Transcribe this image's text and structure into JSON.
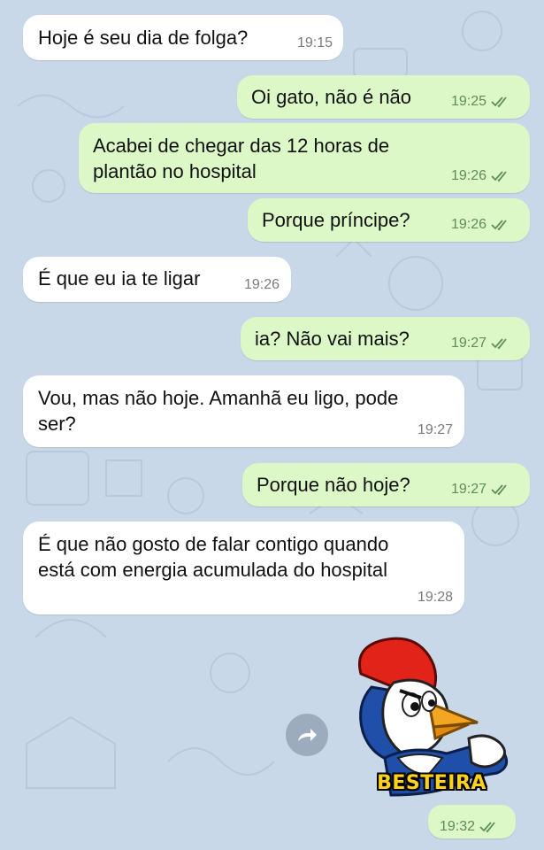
{
  "chat": {
    "messages": [
      {
        "direction": "incoming",
        "text": "Hoje é seu dia de folga?",
        "time": "19:15"
      },
      {
        "direction": "outgoing",
        "text": "Oi gato, não é não",
        "time": "19:25",
        "status": "read"
      },
      {
        "direction": "outgoing",
        "text": "Acabei de chegar das 12 horas de\nplantão no hospital",
        "time": "19:26",
        "status": "read"
      },
      {
        "direction": "outgoing",
        "text": "Porque príncipe?",
        "time": "19:26",
        "status": "read"
      },
      {
        "direction": "incoming",
        "text": "É que eu ia te ligar",
        "time": "19:26"
      },
      {
        "direction": "outgoing",
        "text": "ia? Não vai mais?",
        "time": "19:27",
        "status": "read"
      },
      {
        "direction": "incoming",
        "text": "Vou, mas não hoje. Amanhã eu ligo, pode\nser?",
        "time": "19:27"
      },
      {
        "direction": "outgoing",
        "text": "Porque não hoje?",
        "time": "19:27",
        "status": "read"
      },
      {
        "direction": "incoming",
        "text": "É que não gosto de falar contigo quando\nestá com energia acumulada do hospital",
        "time": "19:28"
      }
    ],
    "sticker": {
      "icon": "woody-woodpecker-sticker",
      "caption": "BESTEIRA",
      "time": "19:32",
      "status": "read"
    },
    "forward_icon": "forward-arrow-icon"
  },
  "colors": {
    "background": "#c9d8e9",
    "incoming_bubble": "#ffffff",
    "outgoing_bubble": "#dcf8c6",
    "read_ticks": "#5e8c5a"
  }
}
